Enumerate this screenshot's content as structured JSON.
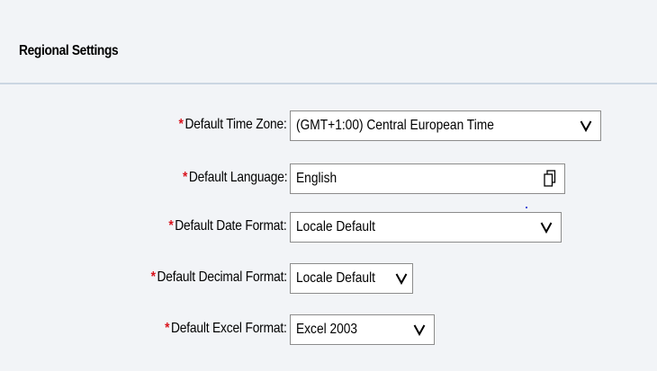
{
  "section": {
    "title": "Regional Settings"
  },
  "fields": [
    {
      "label": "Default Time Zone:",
      "required_mark": "*",
      "value": "(GMT+1:00) Central European Time",
      "control": "dropdown"
    },
    {
      "label": "Default Language:",
      "required_mark": "*",
      "value": "English",
      "control": "value-help"
    },
    {
      "label": "Default Date Format:",
      "required_mark": "*",
      "value": "Locale Default",
      "control": "dropdown"
    },
    {
      "label": "Default Decimal Format:",
      "required_mark": "*",
      "value": "Locale Default",
      "control": "dropdown"
    },
    {
      "label": "Default Excel Format:",
      "required_mark": "*",
      "value": "Excel 2003",
      "control": "dropdown"
    }
  ],
  "colors": {
    "required": "#d9121c",
    "panel_background": "#f2f4f7",
    "header_divider": "#cbd6e2",
    "field_border": "#8c8c8c"
  },
  "icons": {
    "dropdown": "chevron-down-icon",
    "value_help": "copy-icon"
  }
}
